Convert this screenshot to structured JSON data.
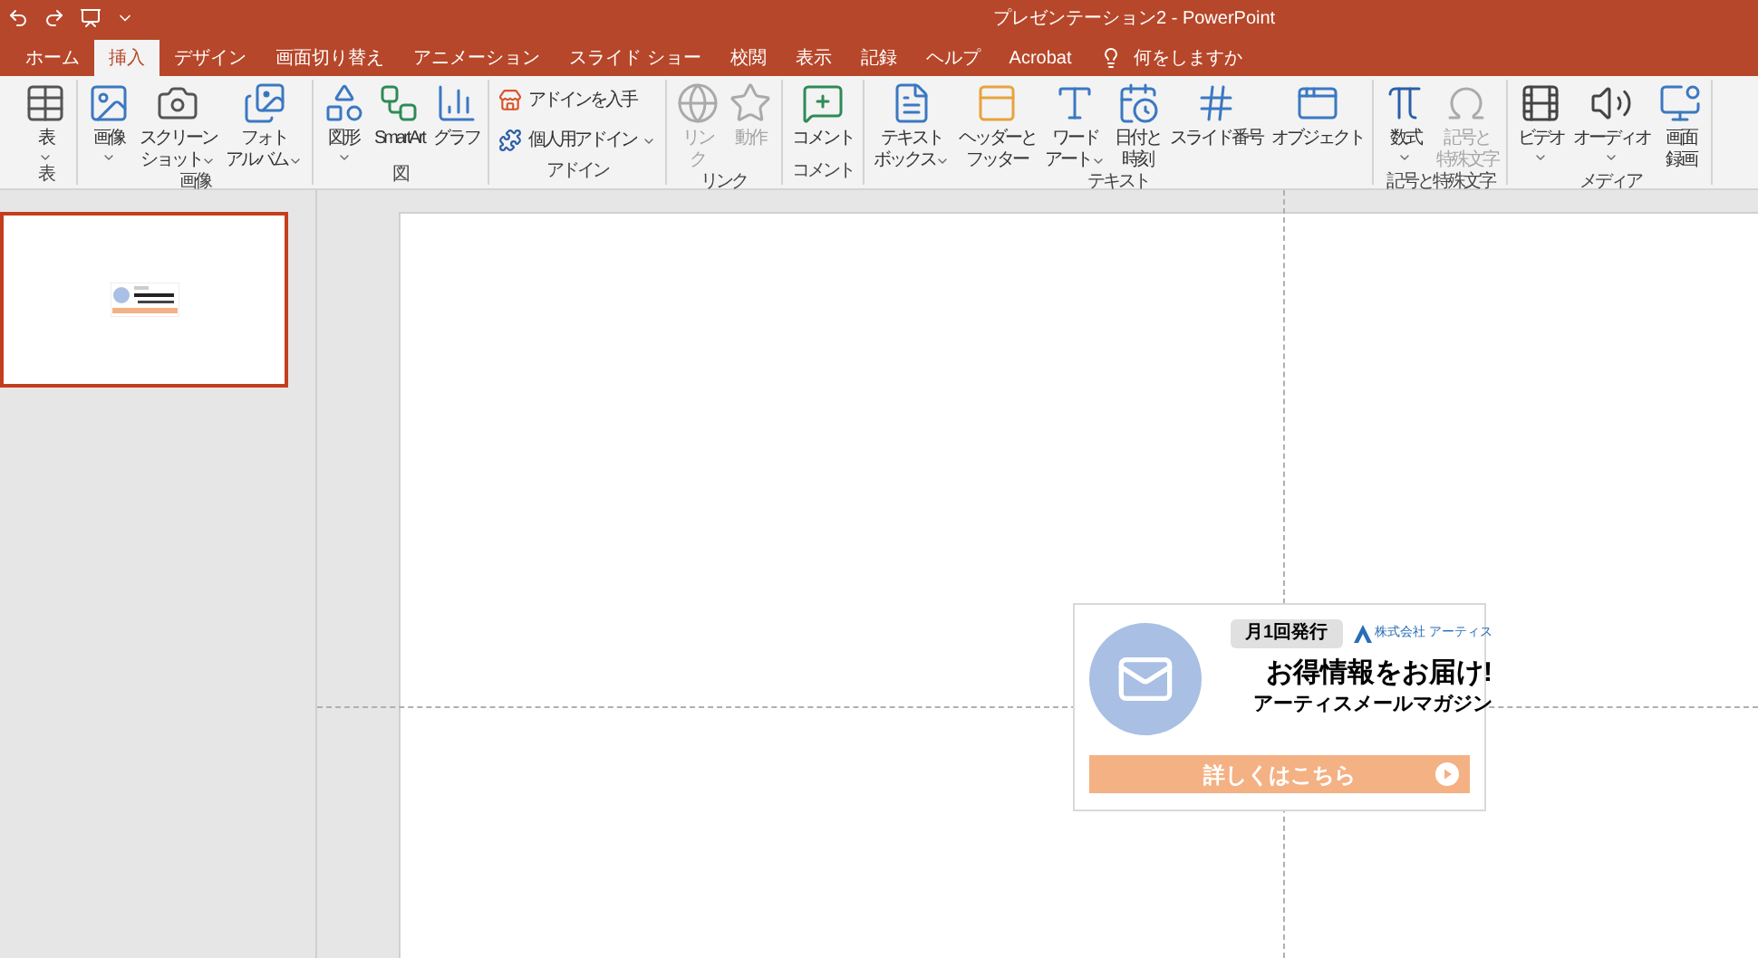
{
  "title_bar": {
    "title": "プレゼンテーション2 - PowerPoint"
  },
  "tabs": [
    {
      "label": "ホーム",
      "selected": false
    },
    {
      "label": "挿入",
      "selected": true
    },
    {
      "label": "デザイン",
      "selected": false
    },
    {
      "label": "画面切り替え",
      "selected": false
    },
    {
      "label": "アニメーション",
      "selected": false
    },
    {
      "label": "スライド ショー",
      "selected": false
    },
    {
      "label": "校閲",
      "selected": false
    },
    {
      "label": "表示",
      "selected": false
    },
    {
      "label": "記録",
      "selected": false
    },
    {
      "label": "ヘルプ",
      "selected": false
    },
    {
      "label": "Acrobat",
      "selected": false
    }
  ],
  "tell_me": {
    "label": "何をしますか"
  },
  "ribbon": {
    "groups": [
      {
        "label": "表",
        "commands": [
          {
            "kind": "large",
            "lines": [
              "表"
            ],
            "dropdown": true,
            "disabled": false
          }
        ]
      },
      {
        "label": "画像",
        "commands": [
          {
            "kind": "large",
            "lines": [
              "画像"
            ],
            "dropdown": true,
            "disabled": false
          },
          {
            "kind": "large",
            "lines": [
              "スクリーン",
              "ショット"
            ],
            "dropdown": true,
            "disabled": false
          },
          {
            "kind": "large",
            "lines": [
              "フォト",
              "アルバム"
            ],
            "dropdown": true,
            "disabled": false
          }
        ]
      },
      {
        "label": "図",
        "commands": [
          {
            "kind": "large",
            "lines": [
              "図形"
            ],
            "dropdown": true,
            "disabled": false
          },
          {
            "kind": "large",
            "lines": [
              "SmartArt"
            ],
            "dropdown": false,
            "disabled": false
          },
          {
            "kind": "large",
            "lines": [
              "グラフ"
            ],
            "dropdown": false,
            "disabled": false
          }
        ]
      },
      {
        "label": "アドイン",
        "commands": [
          {
            "kind": "small",
            "lines": [
              "アドインを入手"
            ],
            "dropdown": false,
            "disabled": false
          },
          {
            "kind": "small",
            "lines": [
              "個人用アドイン"
            ],
            "dropdown": true,
            "disabled": false
          }
        ]
      },
      {
        "label": "リンク",
        "commands": [
          {
            "kind": "large",
            "lines": [
              "リン",
              "ク"
            ],
            "dropdown": false,
            "disabled": true
          },
          {
            "kind": "large",
            "lines": [
              "動作"
            ],
            "dropdown": false,
            "disabled": true
          }
        ]
      },
      {
        "label": "コメント",
        "commands": [
          {
            "kind": "large",
            "lines": [
              "コメント"
            ],
            "dropdown": false,
            "disabled": false
          }
        ]
      },
      {
        "label": "テキスト",
        "commands": [
          {
            "kind": "large",
            "lines": [
              "テキスト",
              "ボックス"
            ],
            "dropdown": true,
            "disabled": false
          },
          {
            "kind": "large",
            "lines": [
              "ヘッダーと",
              "フッター"
            ],
            "dropdown": false,
            "disabled": false
          },
          {
            "kind": "large",
            "lines": [
              "ワード",
              "アート"
            ],
            "dropdown": true,
            "disabled": false
          },
          {
            "kind": "large",
            "lines": [
              "日付と",
              "時刻"
            ],
            "dropdown": false,
            "disabled": false
          },
          {
            "kind": "large",
            "lines": [
              "スライド番号"
            ],
            "dropdown": false,
            "disabled": false
          },
          {
            "kind": "large",
            "lines": [
              "オブジェクト"
            ],
            "dropdown": false,
            "disabled": false
          }
        ]
      },
      {
        "label": "記号と特殊文字",
        "commands": [
          {
            "kind": "large",
            "lines": [
              "数式"
            ],
            "dropdown": true,
            "disabled": false
          },
          {
            "kind": "large",
            "lines": [
              "記号と",
              "特殊文字"
            ],
            "dropdown": false,
            "disabled": true
          }
        ]
      },
      {
        "label": "メディア",
        "commands": [
          {
            "kind": "large",
            "lines": [
              "ビデオ"
            ],
            "dropdown": true,
            "disabled": false
          },
          {
            "kind": "large",
            "lines": [
              "オーディオ"
            ],
            "dropdown": true,
            "disabled": false
          },
          {
            "kind": "large",
            "lines": [
              "画面",
              "録画"
            ],
            "dropdown": false,
            "disabled": false
          }
        ]
      }
    ]
  },
  "slides": [
    {
      "selected": true
    }
  ],
  "banner": {
    "badge": "月1回発行",
    "company": "株式会社 アーティス",
    "headline": "お得情報をお届け!",
    "subtitle": "アーティスメールマガジン",
    "button": "詳しくはこちら"
  }
}
